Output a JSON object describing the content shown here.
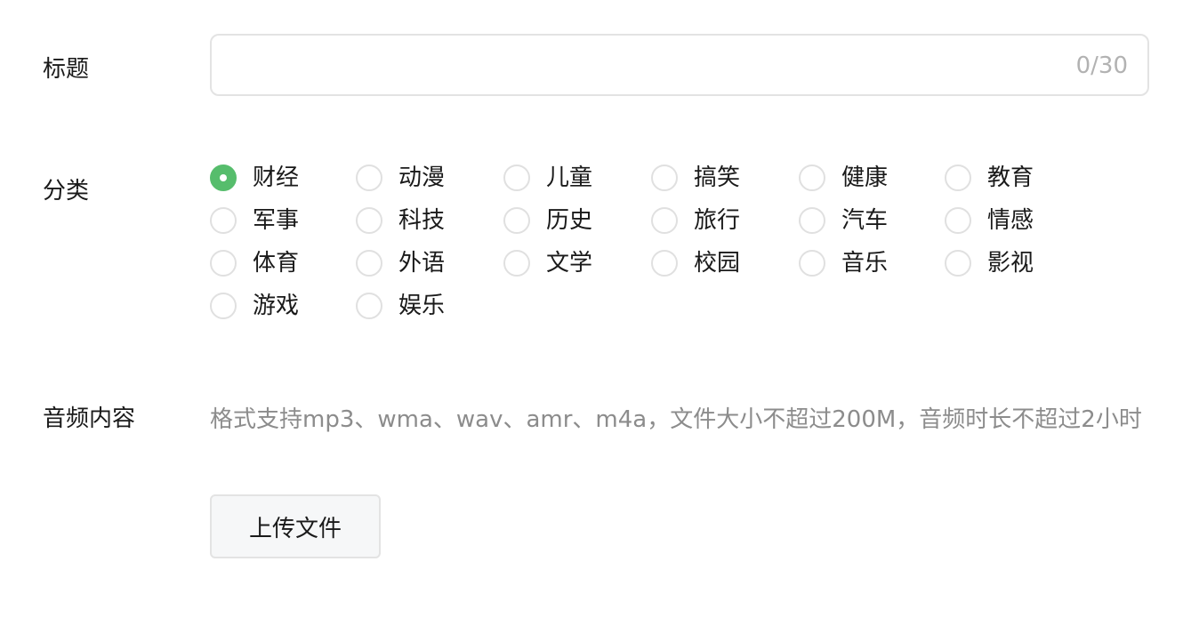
{
  "form": {
    "title_field": {
      "label": "标题",
      "value": "",
      "counter": "0/30"
    },
    "category": {
      "label": "分类",
      "selected": "财经",
      "options": [
        "财经",
        "动漫",
        "儿童",
        "搞笑",
        "健康",
        "教育",
        "军事",
        "科技",
        "历史",
        "旅行",
        "汽车",
        "情感",
        "体育",
        "外语",
        "文学",
        "校园",
        "音乐",
        "影视",
        "游戏",
        "娱乐"
      ]
    },
    "audio": {
      "label": "音频内容",
      "hint": "格式支持mp3、wma、wav、amr、m4a，文件大小不超过200M，音频时长不超过2小时",
      "upload_label": "上传文件"
    }
  },
  "colors": {
    "accent": "#56bd6c",
    "hint_text": "#8c8c8c",
    "border": "#e3e3e3"
  }
}
